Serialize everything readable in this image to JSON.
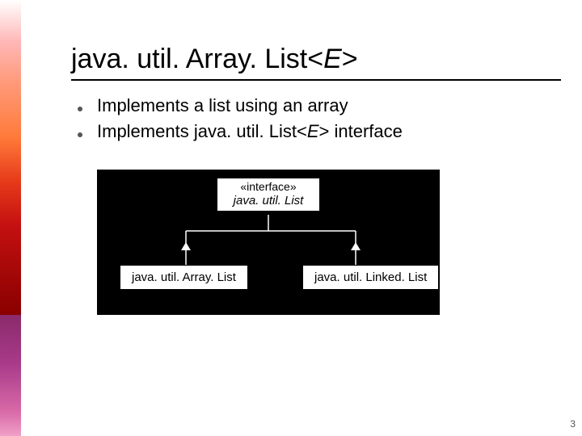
{
  "title": {
    "pre": "java. util. Array. List<",
    "generic": "E",
    "post": ">"
  },
  "bullets": [
    {
      "text": "Implements a list using an array"
    },
    {
      "pre": "Implements java. util. List<",
      "generic": "E",
      "post": "> interface"
    }
  ],
  "diagram": {
    "interface": {
      "stereotype": "«interface»",
      "name": "java. util. List"
    },
    "classes": [
      "java. util. Array. List",
      "java. util. Linked. List"
    ]
  },
  "page_number": "3"
}
